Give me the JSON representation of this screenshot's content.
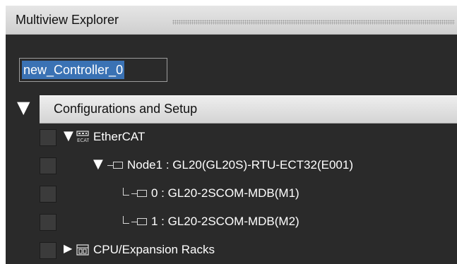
{
  "window": {
    "title": "Multiview Explorer"
  },
  "controller": {
    "name": "new_Controller_0"
  },
  "section": {
    "label": "Configurations and Setup"
  },
  "tree": {
    "ethercat": {
      "label": "EtherCAT",
      "icon": "ethercat-icon",
      "expanded": true
    },
    "node1": {
      "label": "Node1 : GL20(GL20S)-RTU-ECT32(E001)",
      "icon": "node-connector-icon",
      "expanded": true
    },
    "module0": {
      "label": "0 : GL20-2SCOM-MDB(M1)",
      "icon": "module-connector-icon"
    },
    "module1": {
      "label": "1 : GL20-2SCOM-MDB(M2)",
      "icon": "module-connector-icon"
    },
    "cpu": {
      "label": "CPU/Expansion Racks",
      "icon": "rack-icon",
      "expanded": false
    }
  },
  "colors": {
    "panel_bg": "#2a2a2a",
    "selection": "#3a72b4",
    "header_bg": "#e0e0e0",
    "text_light": "#ffffff"
  }
}
